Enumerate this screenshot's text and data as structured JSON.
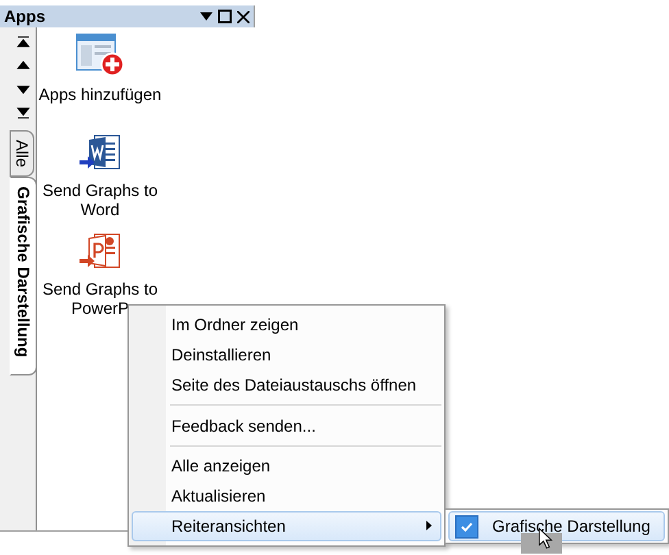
{
  "panel": {
    "title": "Apps",
    "tabs": [
      {
        "label": "Alle",
        "selected": false
      },
      {
        "label": "Grafische Darstellung",
        "selected": true
      }
    ],
    "apps": [
      {
        "kind": "add",
        "label": "Apps hinzufügen"
      },
      {
        "kind": "word",
        "label": "Send Graphs to Word"
      },
      {
        "kind": "powerpoint",
        "label": "Send Graphs to PowerP"
      }
    ]
  },
  "context_menu": {
    "items": [
      {
        "kind": "item",
        "label": "Im Ordner zeigen",
        "selected": false
      },
      {
        "kind": "item",
        "label": "Deinstallieren",
        "selected": false
      },
      {
        "kind": "item",
        "label": "Seite des Dateiaustauschs öffnen",
        "selected": false
      },
      {
        "kind": "separator"
      },
      {
        "kind": "item",
        "label": "Feedback senden...",
        "selected": false
      },
      {
        "kind": "separator"
      },
      {
        "kind": "item",
        "label": "Alle anzeigen",
        "selected": false
      },
      {
        "kind": "item",
        "label": "Aktualisieren",
        "selected": false
      },
      {
        "kind": "submenu",
        "label": "Reiteransichten",
        "selected": true
      }
    ],
    "submenu": [
      {
        "label": "Grafische Darstellung",
        "checked": true
      }
    ]
  }
}
